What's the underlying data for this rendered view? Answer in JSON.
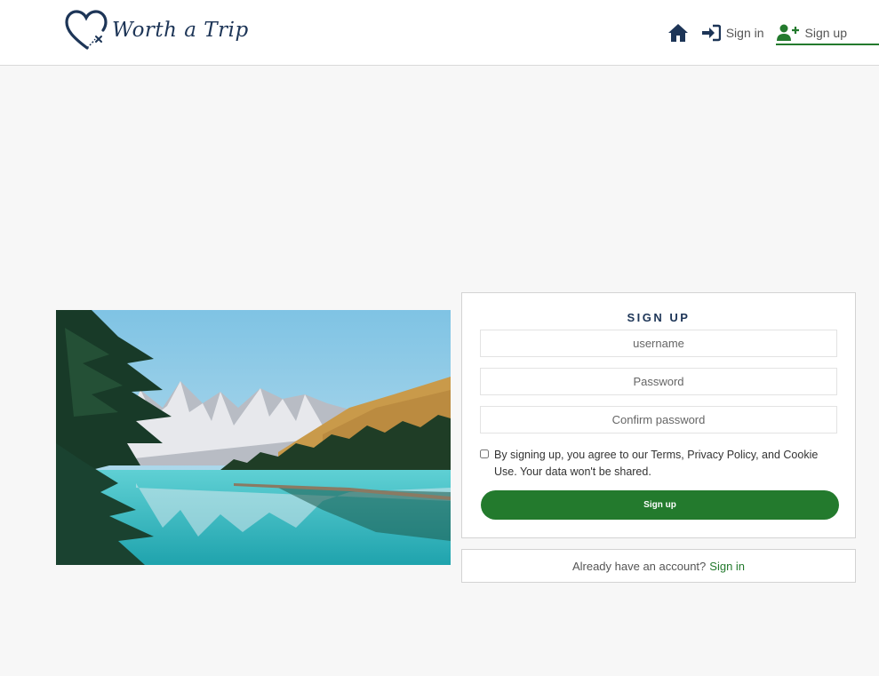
{
  "brand": {
    "name": "Worth a Trip"
  },
  "nav": {
    "home_icon": "home-icon",
    "signin_label": "Sign in",
    "signin_icon": "sign-in-icon",
    "signup_label": "Sign up",
    "signup_icon": "user-plus-icon",
    "active": "signup"
  },
  "signup_form": {
    "title": "SIGN UP",
    "username_placeholder": "username",
    "password_placeholder": "Password",
    "confirm_placeholder": "Confirm password",
    "agree_text": "By signing up, you agree to our Terms, Privacy Policy, and Cookie Use. Your data won't be shared.",
    "agree_checked": false,
    "submit_label": "Sign up"
  },
  "signin_prompt": {
    "text": "Already have an account?",
    "link_label": "Sign in"
  },
  "colors": {
    "brand_navy": "#1d3557",
    "accent_green": "#237a2d",
    "background": "#f7f7f7"
  }
}
